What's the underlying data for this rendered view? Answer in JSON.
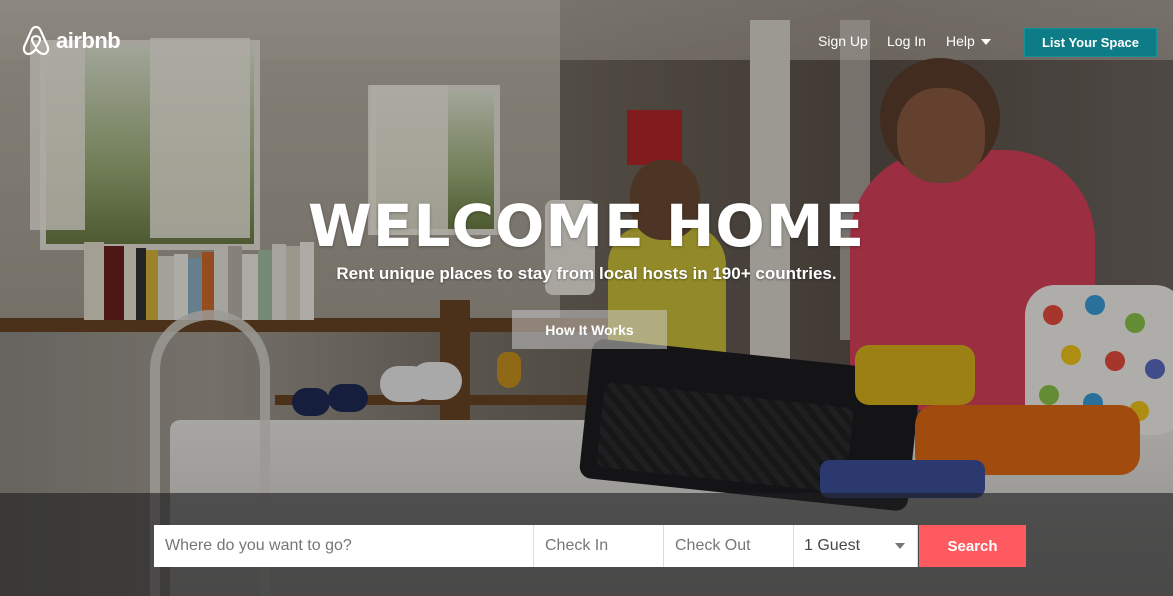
{
  "header": {
    "brand": "airbnb",
    "nav": {
      "sign_up": "Sign Up",
      "log_in": "Log In",
      "help": "Help"
    },
    "list_space": "List Your Space"
  },
  "hero": {
    "headline": "WELCOME HOME",
    "subline": "Rent unique places to stay from local hosts in 190+ countries.",
    "how_it_works": "How It Works"
  },
  "search": {
    "where_placeholder": "Where do you want to go?",
    "check_in_placeholder": "Check In",
    "check_out_placeholder": "Check Out",
    "guests_value": "1 Guest",
    "button": "Search"
  },
  "colors": {
    "accent_teal": "#0e7c86",
    "search_coral": "#ff5a5f"
  },
  "icons": {
    "logo": "airbnb-belo-icon",
    "help_dropdown": "chevron-down-icon",
    "guests_dropdown": "chevron-down-icon"
  }
}
